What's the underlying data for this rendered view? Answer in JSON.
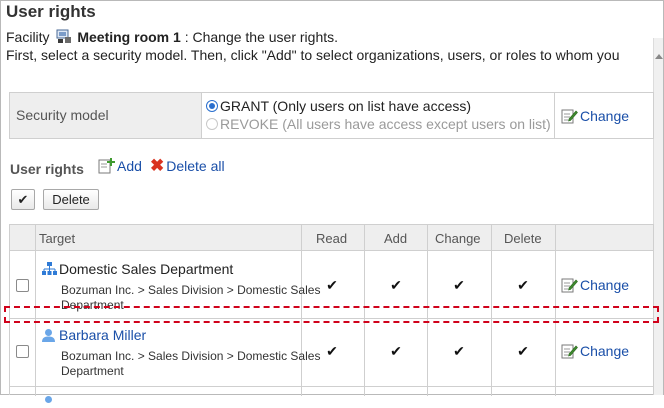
{
  "header": {
    "title": "User rights",
    "facility_prefix": "Facility",
    "facility_name": "Meeting room 1",
    "facility_suffix": ": Change the user rights.",
    "instruction": "First, select a security model. Then, click \"Add\" to select organizations, users, or roles to whom you"
  },
  "security_model": {
    "label": "Security model",
    "options": [
      {
        "label": "GRANT (Only users on list have access)",
        "selected": true,
        "enabled": true
      },
      {
        "label": "REVOKE (All users have access except users on list)",
        "selected": false,
        "enabled": false
      }
    ],
    "change_label": "Change"
  },
  "user_rights": {
    "label": "User rights",
    "add_label": "Add",
    "delete_all_label": "Delete all",
    "check_all_label": "✔",
    "delete_label": "Delete"
  },
  "table": {
    "columns": [
      "Target",
      "Read",
      "Add",
      "Change",
      "Delete"
    ],
    "rows": [
      {
        "type": "organization",
        "name": "Domestic Sales Department",
        "path": "Bozuman Inc. > Sales Division > Domestic Sales Department",
        "read": "✔",
        "add": "✔",
        "change": "✔",
        "delete": "✔",
        "change_label": "Change"
      },
      {
        "type": "user",
        "name": "Barbara Miller",
        "path": "Bozuman Inc. > Sales Division > Domestic Sales Department",
        "read": "✔",
        "add": "✔",
        "change": "✔",
        "delete": "✔",
        "change_label": "Change"
      }
    ]
  },
  "colors": {
    "link": "#1a4fa8",
    "highlight": "#d0021b",
    "header_bg": "#eeeeee"
  }
}
